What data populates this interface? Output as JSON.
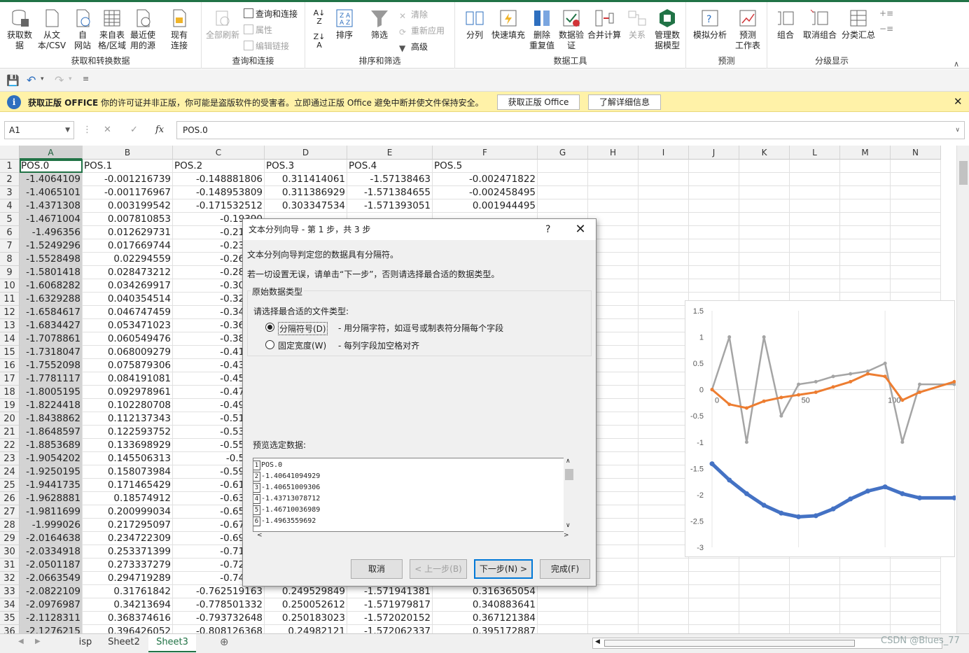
{
  "ribbon": {
    "groups": [
      {
        "label": "获取和转换数据",
        "buttons": [
          "获取数\n据",
          "从文\n本/CSV",
          "自\n网站",
          "来自表\n格/区域",
          "最近使\n用的源",
          "现有\n连接"
        ]
      },
      {
        "label": "查询和连接",
        "buttons": [
          "全部刷新",
          "查询和连接",
          "属性",
          "编辑链接"
        ]
      },
      {
        "label": "排序和筛选",
        "buttons": [
          "排序",
          "筛选",
          "清除",
          "重新应用",
          "高级"
        ]
      },
      {
        "label": "数据工具",
        "buttons": [
          "分列",
          "快速填充",
          "删除\n重复值",
          "数据验\n证",
          "合并计算",
          "关系",
          "管理数\n据模型"
        ]
      },
      {
        "label": "预测",
        "buttons": [
          "模拟分析",
          "预测\n工作表"
        ]
      },
      {
        "label": "分级显示",
        "buttons": [
          "组合",
          "取消组合",
          "分类汇总"
        ]
      }
    ]
  },
  "msgbar": {
    "title": "获取正版 OFFICE",
    "text": "你的许可证并非正版，你可能是盗版软件的受害者。立即通过正版 Office 避免中断并使文件保持安全。",
    "btn1": "获取正版 Office",
    "btn2": "了解详细信息"
  },
  "formula_bar": {
    "name_box": "A1",
    "formula": "POS.0"
  },
  "columns": [
    "A",
    "B",
    "C",
    "D",
    "E",
    "F",
    "G",
    "H",
    "I",
    "J",
    "K",
    "L",
    "M",
    "N"
  ],
  "headers": [
    "POS.0",
    "POS.1",
    "POS.2",
    "POS.3",
    "POS.4",
    "POS.5"
  ],
  "rows": [
    [
      "-1.4064109",
      "-0.001216739",
      "-0.148881806",
      "0.311414061",
      "-1.57138463",
      "-0.002471822"
    ],
    [
      "-1.4065101",
      "-0.001176967",
      "-0.148953809",
      "0.311386929",
      "-1.571384655",
      "-0.002458495"
    ],
    [
      "-1.4371308",
      "0.003199542",
      "-0.171532512",
      "0.303347534",
      "-1.571393051",
      "0.001944495"
    ],
    [
      "-1.4671004",
      "0.007810853",
      "-0.19390",
      "",
      "",
      ""
    ],
    [
      "-1.496356",
      "0.012629731",
      "-0.21625",
      "",
      "",
      ""
    ],
    [
      "-1.5249296",
      "0.017669744",
      "-0.23836",
      "",
      "",
      ""
    ],
    [
      "-1.5528498",
      "0.02294559",
      "-0.26032",
      "",
      "",
      ""
    ],
    [
      "-1.5801418",
      "0.028473212",
      "-0.28214",
      "",
      "",
      ""
    ],
    [
      "-1.6068282",
      "0.034269917",
      "-0.30384",
      "",
      "",
      ""
    ],
    [
      "-1.6329288",
      "0.040354514",
      "-0.32542",
      "",
      "",
      ""
    ],
    [
      "-1.6584617",
      "0.046747459",
      "-0.34690",
      "",
      "",
      ""
    ],
    [
      "-1.6834427",
      "0.053471023",
      "-0.36827",
      "",
      "",
      ""
    ],
    [
      "-1.7078861",
      "0.060549476",
      "-0.38954",
      "",
      "",
      ""
    ],
    [
      "-1.7318047",
      "0.068009279",
      "-0.41072",
      "",
      "",
      ""
    ],
    [
      "-1.7552098",
      "0.075879306",
      "-0.43180",
      "",
      "",
      ""
    ],
    [
      "-1.7781117",
      "0.084191081",
      "-0.45279",
      "",
      "",
      ""
    ],
    [
      "-1.8005195",
      "0.092978961",
      "-0.47367",
      "",
      "",
      ""
    ],
    [
      "-1.8224418",
      "0.102280708",
      "-0.49444",
      "",
      "",
      ""
    ],
    [
      "-1.8438862",
      "0.112137343",
      "-0.51509",
      "",
      "",
      ""
    ],
    [
      "-1.8648597",
      "0.122593752",
      "-0.53561",
      "",
      "",
      ""
    ],
    [
      "-1.8853689",
      "0.133698929",
      "-0.55599",
      "",
      "",
      ""
    ],
    [
      "-1.9054202",
      "0.145506313",
      "-0.5762",
      "",
      "",
      ""
    ],
    [
      "-1.9250195",
      "0.158073984",
      "-0.59624",
      "",
      "",
      ""
    ],
    [
      "-1.9441735",
      "0.171465429",
      "-0.61607",
      "",
      "",
      ""
    ],
    [
      "-1.9628881",
      "0.18574912",
      "-0.63565",
      "",
      "",
      ""
    ],
    [
      "-1.9811699",
      "0.200999034",
      "-0.65497",
      "",
      "",
      ""
    ],
    [
      "-1.999026",
      "0.217295097",
      "-0.67397",
      "",
      "",
      ""
    ],
    [
      "-2.0164638",
      "0.234722309",
      "-0.69261",
      "",
      "",
      ""
    ],
    [
      "-2.0334918",
      "0.253371399",
      "-0.71084",
      "",
      "",
      ""
    ],
    [
      "-2.0501187",
      "0.273337279",
      "-0.72862",
      "",
      "",
      ""
    ],
    [
      "-2.0663549",
      "0.294719289",
      "-0.74586",
      "",
      "",
      ""
    ],
    [
      "-2.0822109",
      "0.31761842",
      "-0.762519163",
      "0.249529849",
      "-1.571941381",
      "0.316365054"
    ],
    [
      "-2.0976987",
      "0.34213694",
      "-0.778501332",
      "0.250052612",
      "-1.571979817",
      "0.340883641"
    ],
    [
      "-2.1128311",
      "0.368374616",
      "-0.793732648",
      "0.250183023",
      "-1.572020152",
      "0.367121384"
    ],
    [
      "-2.1276215",
      "0.396426052",
      "-0.808126368",
      "0.24982121",
      "-1.572062337",
      "0.395172887"
    ]
  ],
  "row_numbers": [
    "1",
    "2",
    "3",
    "4",
    "5",
    "6",
    "7",
    "8",
    "9",
    "10",
    "11",
    "12",
    "13",
    "14",
    "15",
    "16",
    "17",
    "18",
    "19",
    "20",
    "21",
    "22",
    "23",
    "24",
    "25",
    "26",
    "27",
    "28",
    "29",
    "30",
    "31",
    "32",
    "33",
    "34",
    "35",
    "36"
  ],
  "sheet_tabs": [
    "isp",
    "Sheet2",
    "Sheet3"
  ],
  "active_tab": "Sheet3",
  "chart": {
    "y_ticks": [
      "1.5",
      "1",
      "0.5",
      "0",
      "-0.5",
      "-1",
      "-1.5",
      "-2",
      "-2.5",
      "-3"
    ],
    "x_ticks": [
      "0",
      "50",
      "100"
    ],
    "colors": {
      "blue": "#4472c4",
      "orange": "#ed7d31",
      "gray": "#a5a5a5"
    }
  },
  "chart_data": {
    "type": "line",
    "ylim": [
      -3,
      1.5
    ],
    "x": [
      0,
      10,
      20,
      30,
      40,
      50,
      60,
      70,
      80,
      90,
      100,
      110,
      120,
      140
    ],
    "series": [
      {
        "values": [
          -1.41,
          -1.72,
          -1.98,
          -2.2,
          -2.35,
          -2.42,
          -2.4,
          -2.27,
          -2.08,
          -1.93,
          -1.85,
          -1.98,
          -2.06,
          -2.06
        ]
      },
      {
        "values": [
          0.0,
          -0.28,
          -0.35,
          -0.22,
          -0.15,
          -0.1,
          -0.05,
          0.05,
          0.15,
          0.3,
          0.25,
          -0.2,
          -0.05,
          0.15
        ]
      },
      {
        "values": [
          0.0,
          1.0,
          -1.0,
          1.0,
          -0.5,
          0.1,
          0.15,
          0.25,
          0.3,
          0.35,
          0.5,
          -1.0,
          0.1,
          0.1
        ]
      }
    ]
  },
  "dialog": {
    "title": "文本分列向导 - 第 1 步，共 3 步",
    "help": "?",
    "line1": "文本分列向导判定您的数据具有分隔符。",
    "line2": "若一切设置无误，请单击“下一步”，否则请选择最合适的数据类型。",
    "group": "原始数据类型",
    "prompt": "请选择最合适的文件类型:",
    "opt1": "分隔符号(D)",
    "opt1_desc": "- 用分隔字符，如逗号或制表符分隔每个字段",
    "opt2": "固定宽度(W)",
    "opt2_desc": "- 每列字段加空格对齐",
    "preview_label": "预览选定数据:",
    "preview": [
      {
        "n": "1",
        "t": "POS.0"
      },
      {
        "n": "2",
        "t": "-1.40641094929"
      },
      {
        "n": "3",
        "t": "-1.40651009306"
      },
      {
        "n": "4",
        "t": "-1.43713078712"
      },
      {
        "n": "5",
        "t": "-1.46710036989"
      },
      {
        "n": "6",
        "t": "-1.4963559692"
      }
    ],
    "btn_cancel": "取消",
    "btn_back": "< 上一步(B)",
    "btn_next": "下一步(N) >",
    "btn_finish": "完成(F)"
  },
  "watermark": "CSDN @Blues_77"
}
